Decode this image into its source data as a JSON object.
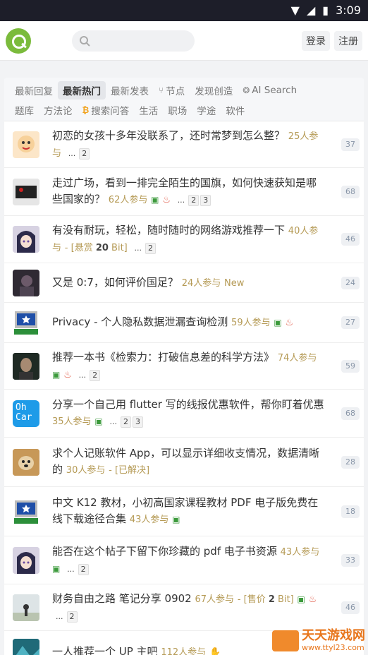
{
  "status": {
    "time": "3:09"
  },
  "header": {
    "search_placeholder": "",
    "login": "登录",
    "register": "注册"
  },
  "tabs": {
    "row1": [
      "最新回复",
      "最新热门",
      "最新发表",
      "节点",
      "发现创造",
      "AI Search"
    ],
    "row2": [
      "题库",
      "方法论",
      "搜索问答",
      "生活",
      "职场",
      "学途",
      "软件"
    ]
  },
  "topics": [
    {
      "title": "初恋的女孩十多年没联系了，还时常梦到怎么整？",
      "participants": "25人参与",
      "pages": [
        "...",
        "2"
      ],
      "count": "37"
    },
    {
      "title": "走过广场，看到一排完全陌生的国旗，如何快速获知是哪些国家的？",
      "participants": "62人参与",
      "pages": [
        "...",
        "2",
        "3"
      ],
      "count": "68"
    },
    {
      "title": "有没有耐玩，轻松，随时随时的网络游戏推荐一下",
      "participants": "40人参与",
      "bounty_prefix": "- [悬赏 ",
      "bounty_value": "20",
      "bounty_suffix": " Bit]",
      "pages": [
        "...",
        "2"
      ],
      "count": "46"
    },
    {
      "title": "又是 0:7，如何评价国足？",
      "participants": "24人参与",
      "new_label": "New",
      "count": "24"
    },
    {
      "title": "Privacy - 个人隐私数据泄漏查询检测",
      "participants": "59人参与",
      "count": "27"
    },
    {
      "title": "推荐一本书《检索力：打破信息差的科学方法》",
      "participants": "74人参与",
      "pages": [
        "...",
        "2"
      ],
      "count": "59"
    },
    {
      "title": "分享一个自己用 flutter 写的线报优惠软件，帮你盯着优惠",
      "participants": "35人参与",
      "pages": [
        "...",
        "2",
        "3"
      ],
      "count": "68"
    },
    {
      "title": "求个人记账软件 App，可以显示详细收支情况，数据清晰的",
      "participants": "30人参与",
      "solved": "- [已解决]",
      "count": "28"
    },
    {
      "title": "中文 K12 教材，小初高国家课程教材 PDF 电子版免费在线下载途径合集",
      "participants": "43人参与",
      "count": "18"
    },
    {
      "title": "能否在这个帖子下留下你珍藏的 pdf 电子书资源",
      "participants": "43人参与",
      "pages": [
        "...",
        "2"
      ],
      "count": "33"
    },
    {
      "title": "财务自由之路 笔记分享 0902",
      "participants": "67人参与",
      "sale_prefix": "- [售价 ",
      "sale_value": "2",
      "sale_suffix": " Bit]",
      "pages": [
        "...",
        "2"
      ],
      "count": "46"
    },
    {
      "title": "一人推荐一个 UP 主吧",
      "participants": "112人参与"
    }
  ],
  "avatars": [
    "baby",
    "flag-dark",
    "anime-girl",
    "dark-photo",
    "computer-icon",
    "photo-man",
    "ohcar-logo",
    "dog-photo",
    "computer-icon",
    "anime-girl",
    "beach-photo",
    "teal-photo"
  ],
  "ohcar": {
    "line1": "Oh",
    "line2": "Car"
  },
  "watermark": {
    "text": "天天游戏网",
    "url": "www.ttyl23.com"
  }
}
